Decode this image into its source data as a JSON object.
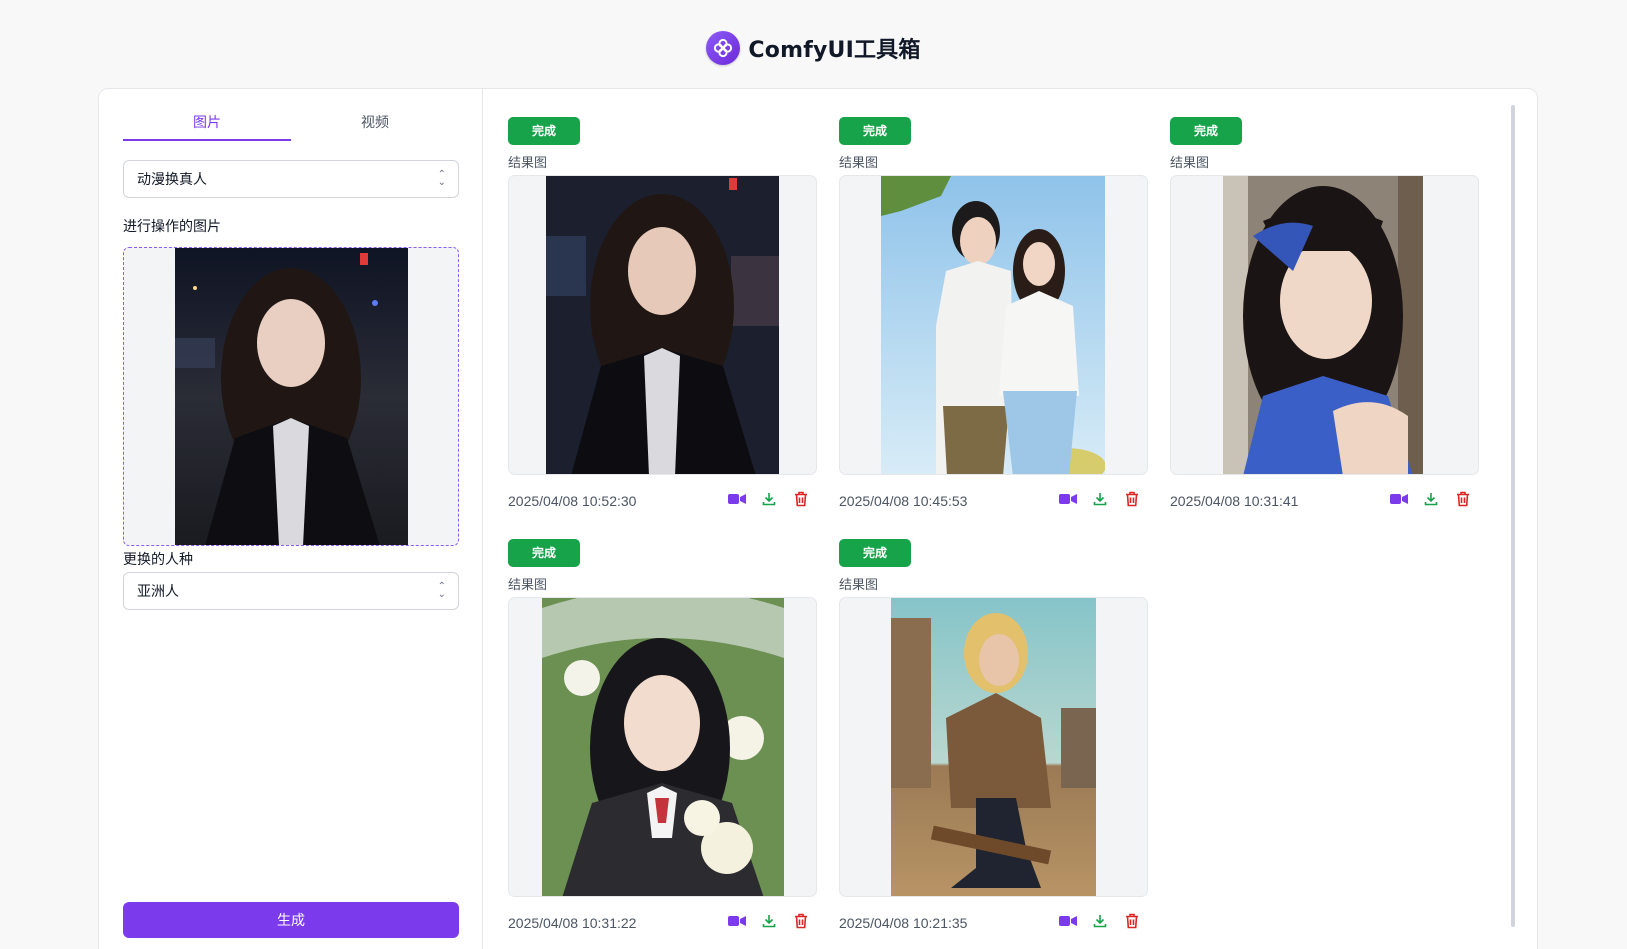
{
  "app": {
    "title": "ComfyUI工具箱"
  },
  "sidebar": {
    "tabs": [
      {
        "label": "图片",
        "active": true
      },
      {
        "label": "视频",
        "active": false
      }
    ],
    "workflow_select": {
      "value": "动漫换真人"
    },
    "source_label": "进行操作的图片",
    "race_label": "更换的人种",
    "race_select": {
      "value": "亚洲人"
    },
    "generate_label": "生成"
  },
  "results": [
    {
      "status": "完成",
      "label": "结果图",
      "timestamp": "2025/04/08 10:52:30"
    },
    {
      "status": "完成",
      "label": "结果图",
      "timestamp": "2025/04/08 10:45:53"
    },
    {
      "status": "完成",
      "label": "结果图",
      "timestamp": "2025/04/08 10:31:41"
    },
    {
      "status": "完成",
      "label": "结果图",
      "timestamp": "2025/04/08 10:31:22"
    },
    {
      "status": "完成",
      "label": "结果图",
      "timestamp": "2025/04/08 10:21:35"
    }
  ],
  "colors": {
    "accent": "#7c3aed",
    "success": "#16a34a",
    "danger": "#dc2626"
  },
  "icons": [
    "logo-icon",
    "video-icon",
    "download-icon",
    "trash-icon",
    "chevron-updown-icon"
  ]
}
